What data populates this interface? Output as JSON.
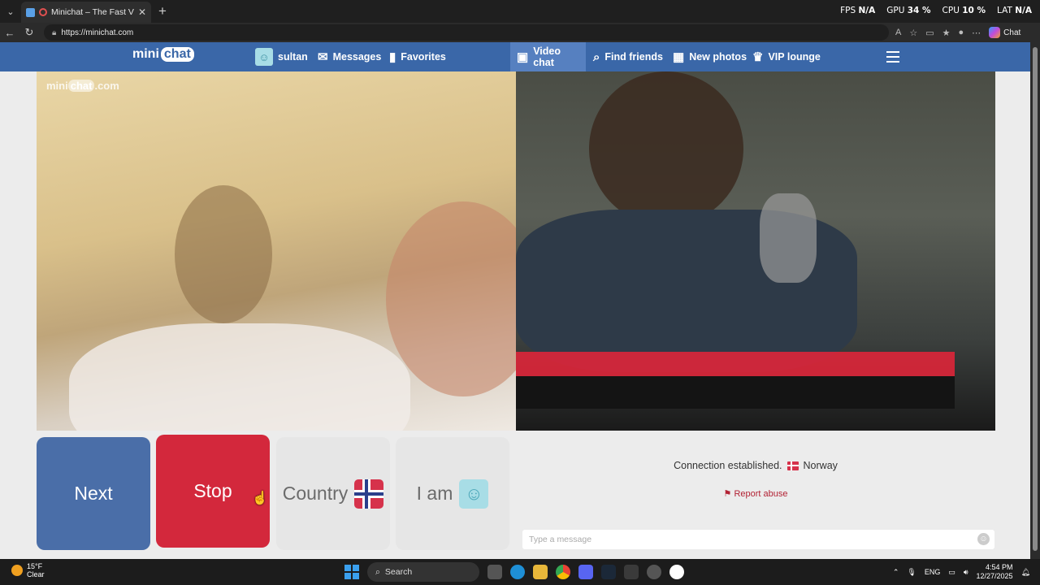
{
  "browser": {
    "tab_title": "Minichat – The Fast Video Chat",
    "url": "https://minichat.com",
    "chat_label": "Chat",
    "stats": [
      {
        "label": "FPS",
        "value": "N/A"
      },
      {
        "label": "GPU",
        "value": "34 %"
      },
      {
        "label": "CPU",
        "value": "10 %"
      },
      {
        "label": "LAT",
        "value": "N/A"
      }
    ]
  },
  "site": {
    "logo_left": "mini",
    "logo_right": "chat",
    "nav": {
      "user": "sultan",
      "messages": "Messages",
      "favorites": "Favorites",
      "video_chat": "Video chat",
      "find_friends": "Find friends",
      "new_photos": "New photos",
      "vip_lounge": "VIP lounge"
    },
    "watermark_left": "mini",
    "watermark_mid": "chat",
    "watermark_right": ".com",
    "buttons": {
      "next": "Next",
      "stop": "Stop",
      "country": "Country",
      "iam": "I am"
    },
    "chat": {
      "status": "Connection established.",
      "country": "Norway",
      "report": "Report abuse",
      "placeholder": "Type a message"
    }
  },
  "taskbar": {
    "temp": "15°F",
    "weather": "Clear",
    "search": "Search",
    "lang": "ENG",
    "time": "4:54 PM",
    "date": "12/27/2025"
  },
  "colors": {
    "nav": "#3a67a8",
    "next": "#4a6ea8",
    "stop": "#d3283c"
  }
}
